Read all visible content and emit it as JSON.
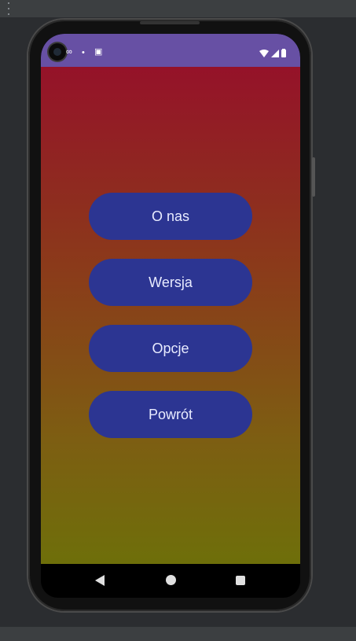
{
  "status_bar": {
    "background": "#6750a4",
    "left_icons": [
      "data-saver-icon",
      "dot-icon",
      "cast-icon"
    ],
    "right_icons": [
      "wifi-icon",
      "signal-icon",
      "battery-icon"
    ]
  },
  "menu": {
    "button_color": "#2c3592",
    "buttons": [
      {
        "label": "O nas"
      },
      {
        "label": "Wersja"
      },
      {
        "label": "Opcje"
      },
      {
        "label": "Powrót"
      }
    ]
  },
  "background_gradient": [
    "#951229",
    "#8b3a1a",
    "#7d5e12",
    "#6e6f0a"
  ],
  "navigation": [
    "back-icon",
    "home-icon",
    "recents-icon"
  ]
}
